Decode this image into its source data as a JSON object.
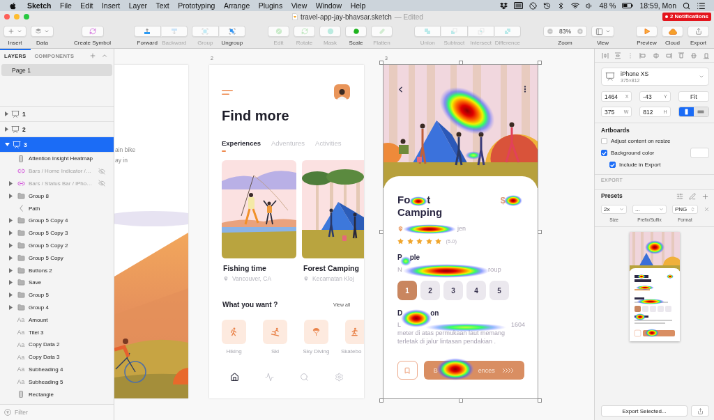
{
  "menu_bar": {
    "menus": [
      "Sketch",
      "File",
      "Edit",
      "Insert",
      "Layer",
      "Text",
      "Prototyping",
      "Arrange",
      "Plugins",
      "View",
      "Window",
      "Help"
    ],
    "battery": "48 %",
    "clock": "18:59, Mon"
  },
  "window": {
    "title": "travel-app-jay-bhavsar.sketch",
    "status": "— Edited",
    "notifications": "2 Notifications"
  },
  "toolbar": [
    {
      "kind": "menu",
      "buttons": [
        {
          "label": "Insert",
          "disabled": false
        }
      ]
    },
    {
      "kind": "menu",
      "buttons": [
        {
          "label": "Data",
          "disabled": false
        }
      ]
    },
    {
      "kind": "single",
      "buttons": [
        {
          "label": "Create Symbol",
          "disabled": false
        }
      ]
    },
    {
      "kind": "segmented",
      "buttons": [
        {
          "label": "Forward",
          "disabled": false
        },
        {
          "label": "Backward",
          "disabled": true
        }
      ]
    },
    {
      "kind": "segmented",
      "buttons": [
        {
          "label": "Group",
          "disabled": true
        },
        {
          "label": "Ungroup",
          "disabled": false
        }
      ]
    },
    {
      "kind": "single",
      "buttons": [
        {
          "label": "Edit",
          "disabled": true
        }
      ]
    },
    {
      "kind": "single",
      "buttons": [
        {
          "label": "Rotate",
          "disabled": true
        }
      ]
    },
    {
      "kind": "single",
      "buttons": [
        {
          "label": "Mask",
          "disabled": true
        }
      ]
    },
    {
      "kind": "single",
      "buttons": [
        {
          "label": "Scale",
          "disabled": false
        }
      ]
    },
    {
      "kind": "single",
      "buttons": [
        {
          "label": "Flatten",
          "disabled": true
        }
      ]
    },
    {
      "kind": "segmented",
      "buttons": [
        {
          "label": "Union",
          "disabled": true
        },
        {
          "label": "Subtract",
          "disabled": true
        },
        {
          "label": "Intersect",
          "disabled": true
        },
        {
          "label": "Difference",
          "disabled": true
        }
      ]
    },
    {
      "kind": "zoom",
      "value": "83%",
      "buttons": [
        {
          "label": "Zoom",
          "disabled": false
        }
      ]
    },
    {
      "kind": "menu",
      "buttons": [
        {
          "label": "View",
          "disabled": false
        }
      ]
    },
    {
      "kind": "single",
      "buttons": [
        {
          "label": "Preview",
          "disabled": false
        }
      ]
    },
    {
      "kind": "single",
      "buttons": [
        {
          "label": "Cloud",
          "disabled": false
        }
      ]
    },
    {
      "kind": "single",
      "buttons": [
        {
          "label": "Export",
          "disabled": false
        }
      ]
    }
  ],
  "layers_panel": {
    "tabs": [
      {
        "label": "LAYERS",
        "selected": true
      },
      {
        "label": "COMPONENTS",
        "selected": false
      }
    ],
    "pages": [
      {
        "label": "Page 1",
        "selected": true
      }
    ],
    "layers": [
      {
        "label": "1",
        "expanded": false,
        "selected": false
      },
      {
        "label": "2",
        "expanded": false,
        "selected": false
      },
      {
        "label": "3",
        "expanded": true,
        "selected": true,
        "children": [
          {
            "kind": "rectangle",
            "label": "Attention Insight Heatmap",
            "hidden": false
          },
          {
            "kind": "symbol",
            "label": "Bars / Home Indicator /…",
            "hidden": true
          },
          {
            "kind": "symbol",
            "label": "Bars / Status Bar / iPho…",
            "hidden": true,
            "expanded": false
          },
          {
            "kind": "group",
            "label": "Group 8",
            "hidden": false,
            "expanded": false
          },
          {
            "kind": "path",
            "label": "Path",
            "hidden": false
          },
          {
            "kind": "group",
            "label": "Group 5 Copy 4",
            "hidden": false,
            "expanded": false
          },
          {
            "kind": "group",
            "label": "Group 5 Copy 3",
            "hidden": false,
            "expanded": false
          },
          {
            "kind": "group",
            "label": "Group 5 Copy 2",
            "hidden": false,
            "expanded": false
          },
          {
            "kind": "group",
            "label": "Group 5 Copy",
            "hidden": false,
            "expanded": false
          },
          {
            "kind": "group",
            "label": "Buttons 2",
            "hidden": false,
            "expanded": false
          },
          {
            "kind": "group",
            "label": "Save",
            "hidden": false,
            "expanded": false
          },
          {
            "kind": "group",
            "label": "Group 5",
            "hidden": false,
            "expanded": false
          },
          {
            "kind": "group",
            "label": "Group 4",
            "hidden": false,
            "expanded": false
          },
          {
            "kind": "text",
            "icon_text": "Aa",
            "label": "Amount",
            "hidden": false
          },
          {
            "kind": "text",
            "icon_text": "Aa",
            "label": "Titel 3",
            "hidden": false
          },
          {
            "kind": "text",
            "icon_text": "Aa",
            "label": "Copy Data 2",
            "hidden": false
          },
          {
            "kind": "text",
            "icon_text": "Aa",
            "label": "Copy Data 3",
            "hidden": false
          },
          {
            "kind": "text",
            "icon_text": "Aa",
            "label": "Subheading 4",
            "hidden": false
          },
          {
            "kind": "text",
            "icon_text": "Aa",
            "label": "Subheading 5",
            "hidden": false
          },
          {
            "kind": "rectangle",
            "label": "Rectangle",
            "hidden": false
          }
        ]
      }
    ],
    "filter": {
      "placeholder": "Filter"
    }
  },
  "canvas": {
    "artboard_1": {
      "selected": false,
      "text_lines": [
        "ain bike",
        "ay in"
      ]
    },
    "artboard_2": {
      "label": "2",
      "selected": false,
      "heading": "Find more",
      "tabs": [
        {
          "label": "Experiences",
          "selected": true
        },
        {
          "label": "Adventures",
          "selected": false
        },
        {
          "label": "Activities",
          "selected": false
        }
      ],
      "cards": [
        {
          "title": "Fishing time",
          "location": "Vancouver, CA"
        },
        {
          "title": "Forest Camping",
          "location": "Kecamatan Kloj"
        }
      ],
      "section_title": "What you want ?",
      "view_all": "View all",
      "categories": [
        {
          "label": "Hiking"
        },
        {
          "label": "Ski"
        },
        {
          "label": "Sky Diving"
        },
        {
          "label": "Skatebo"
        }
      ],
      "bottom_nav": [
        {
          "selected": true
        },
        {
          "selected": false
        },
        {
          "selected": false
        },
        {
          "selected": false
        }
      ]
    },
    "artboard_3": {
      "label": "3",
      "selected": true,
      "title_lines": [
        [
          "Fo",
          "t"
        ],
        [
          "Camping"
        ]
      ],
      "price": "$",
      "location": [
        "jen"
      ],
      "stars": 5,
      "rating": "(5.0)",
      "people_title": [
        "P",
        "ple"
      ],
      "people_hint": [
        "N",
        "roup"
      ],
      "people_options": [
        {
          "label": "1",
          "selected": true
        },
        {
          "label": "2",
          "selected": false
        },
        {
          "label": "3",
          "selected": false
        },
        {
          "label": "4",
          "selected": false
        },
        {
          "label": "5",
          "selected": false
        }
      ],
      "description_title": [
        "D",
        "on"
      ],
      "description_lines": [
        [
          "L",
          "1604"
        ],
        [
          "meter di atas permukaan laut memang"
        ],
        [
          "terletak di jalur lintasan pendakian ."
        ]
      ],
      "book_button": [
        "B",
        "ences"
      ]
    }
  },
  "inspector": {
    "device": {
      "name": "iPhone XS",
      "size": "375×812"
    },
    "position": [
      {
        "value": "1464",
        "axis": "X"
      },
      {
        "value": "-43",
        "axis": "Y"
      }
    ],
    "fit_button": "Fit",
    "size": [
      {
        "value": "375",
        "axis": "W"
      },
      {
        "value": "812",
        "axis": "H"
      }
    ],
    "orientation": [
      {
        "selected": true
      },
      {
        "selected": false
      }
    ],
    "artboards_title": "Artboards",
    "options": [
      {
        "label": "Adjust content on resize",
        "checked": false
      },
      {
        "label": "Background color",
        "checked": true,
        "children": [
          {
            "label": "Include in Export",
            "checked": true
          }
        ]
      }
    ],
    "export_title": "EXPORT",
    "presets_title": "Presets",
    "preset": {
      "size": "2x",
      "prefix_suffix": "...",
      "format": "PNG"
    },
    "preset_labels": [
      "Size",
      "Prefix/Suffix",
      "Format"
    ],
    "export_button": "Export Selected..."
  }
}
